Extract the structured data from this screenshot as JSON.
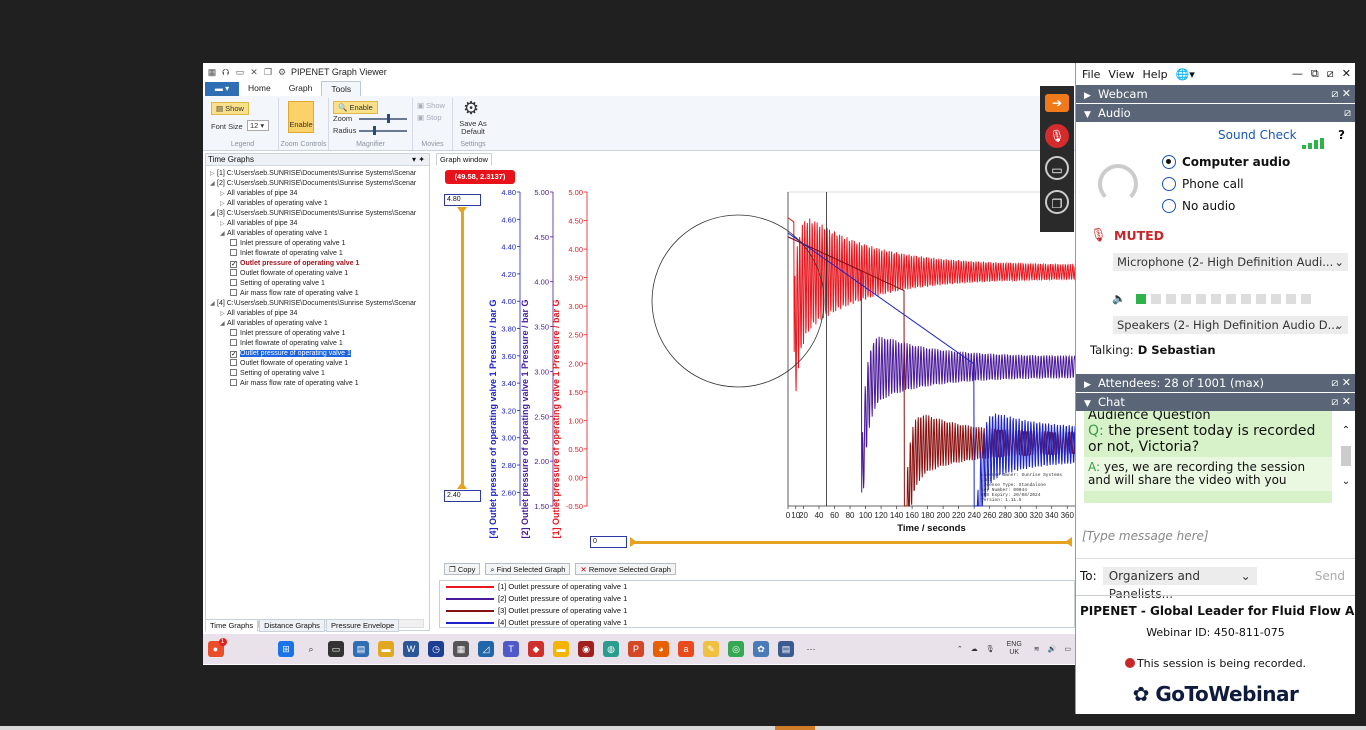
{
  "app": {
    "title": "PIPENET Graph Viewer",
    "tabs": [
      {
        "label": "Home"
      },
      {
        "label": "Graph"
      },
      {
        "label": "Tools"
      }
    ],
    "ribbon": {
      "legend_show": "Show",
      "font_size_label": "Font Size",
      "font_size_value": "12",
      "legend_group": "Legend",
      "zoom_enable": "Enable",
      "zoom_group": "Zoom Controls",
      "mag_enable": "Enable",
      "mag_zoom": "Zoom",
      "mag_radius": "Radius",
      "mag_group": "Magnifier",
      "movie_show": "Show",
      "movie_stop": "Stop",
      "movie_group": "Movies",
      "save_default": "Save As Default",
      "settings_group": "Settings"
    },
    "left_panel": {
      "header": "Time Graphs",
      "tree": [
        {
          "indent": 0,
          "arrow": "▷",
          "cb": false,
          "label": "[1] C:\\Users\\seb.SUNRISE\\Documents\\Sunrise Systems\\Scenar"
        },
        {
          "indent": 0,
          "arrow": "◢",
          "cb": false,
          "label": "[2] C:\\Users\\seb.SUNRISE\\Documents\\Sunrise Systems\\Scenar"
        },
        {
          "indent": 1,
          "arrow": "▷",
          "cb": false,
          "label": "All variables of pipe 34"
        },
        {
          "indent": 1,
          "arrow": "▷",
          "cb": false,
          "label": "All variables of operating valve 1"
        },
        {
          "indent": 0,
          "arrow": "◢",
          "cb": false,
          "label": "[3] C:\\Users\\seb.SUNRISE\\Documents\\Sunrise Systems\\Scenar"
        },
        {
          "indent": 1,
          "arrow": "▷",
          "cb": false,
          "label": "All variables of pipe 34"
        },
        {
          "indent": 1,
          "arrow": "◢",
          "cb": false,
          "label": "All variables of operating valve 1"
        },
        {
          "indent": 2,
          "arrow": "",
          "cb": "off",
          "label": "Inlet pressure of operating valve 1"
        },
        {
          "indent": 2,
          "arrow": "",
          "cb": "off",
          "label": "Inlet flowrate of operating valve 1"
        },
        {
          "indent": 2,
          "arrow": "",
          "cb": "on",
          "style": "red",
          "label": "Outlet pressure of operating valve 1"
        },
        {
          "indent": 2,
          "arrow": "",
          "cb": "off",
          "label": "Outlet flowrate of operating valve 1"
        },
        {
          "indent": 2,
          "arrow": "",
          "cb": "off",
          "label": "Setting of operating valve 1"
        },
        {
          "indent": 2,
          "arrow": "",
          "cb": "off",
          "label": "Air mass flow rate of operating valve 1"
        },
        {
          "indent": 0,
          "arrow": "◢",
          "cb": false,
          "label": "[4] C:\\Users\\seb.SUNRISE\\Documents\\Sunrise Systems\\Scenar"
        },
        {
          "indent": 1,
          "arrow": "▷",
          "cb": false,
          "label": "All variables of pipe 34"
        },
        {
          "indent": 1,
          "arrow": "◢",
          "cb": false,
          "label": "All variables of operating valve 1"
        },
        {
          "indent": 2,
          "arrow": "",
          "cb": "off",
          "label": "Inlet pressure of operating valve 1"
        },
        {
          "indent": 2,
          "arrow": "",
          "cb": "off",
          "label": "Inlet flowrate of operating valve 1"
        },
        {
          "indent": 2,
          "arrow": "",
          "cb": "on",
          "style": "sel",
          "label": "Outlet pressure of operating valve 1"
        },
        {
          "indent": 2,
          "arrow": "",
          "cb": "off",
          "label": "Outlet flowrate of operating valve 1"
        },
        {
          "indent": 2,
          "arrow": "",
          "cb": "off",
          "label": "Setting of operating valve 1"
        },
        {
          "indent": 2,
          "arrow": "",
          "cb": "off",
          "label": "Air mass flow rate of operating valve 1"
        }
      ],
      "bottom_tabs": [
        "Time Graphs",
        "Distance Graphs",
        "Pressure Envelope"
      ]
    },
    "graph": {
      "window_tab": "Graph window",
      "coord_badge": "(49.58, 2.3137)",
      "top_value": "4.80",
      "bottom_value": "2.40",
      "x_start_value": "0",
      "buttons": {
        "copy": "Copy",
        "find": "Find Selected Graph",
        "remove": "Remove Selected Graph"
      },
      "legend": [
        {
          "label": "[1] Outlet pressure of operating valve 1",
          "color": "#e8171f"
        },
        {
          "label": "[2] Outlet pressure of operating valve 1",
          "color": "#4a1a9a"
        },
        {
          "label": "[3] Outlet pressure of operating valve 1",
          "color": "#8a1010"
        },
        {
          "label": "[4] Outlet pressure of operating valve 1",
          "color": "#1a22c8"
        }
      ],
      "license_lines": [
        "License Owner: Sunrise Systems Limi",
        "License Type: Standalone",
        "Key Number: 00044",
        "MUS Expiry: 20/08/2024",
        "Version: 1.11.5"
      ]
    }
  },
  "chart_data": {
    "type": "line",
    "xlabel": "Time / seconds",
    "x_ticks": [
      0,
      10,
      20,
      40,
      60,
      80,
      100,
      120,
      140,
      160,
      180,
      200,
      220,
      240,
      260,
      280,
      300,
      320,
      340,
      360
    ],
    "axes": [
      {
        "label": "[4] Outlet pressure of operating valve 1 Pressure / bar G",
        "color": "#1a22c8",
        "ticks": [
          "4.80",
          "4.60",
          "4.40",
          "4.20",
          "4.00",
          "3.80",
          "3.60",
          "3.40",
          "3.20",
          "3.00",
          "2.80",
          "2.60"
        ],
        "ylim": [
          2.5,
          4.8
        ]
      },
      {
        "label": "[2] Outlet pressure of operating valve 1 Pressure / bar G",
        "color": "#4a1a9a",
        "ticks": [
          "5.00",
          "4.50",
          "4.00",
          "3.50",
          "3.00",
          "2.50",
          "2.00",
          "1.50"
        ],
        "ylim": [
          1.5,
          5.0
        ]
      },
      {
        "label": "[1] Outlet pressure of operating valve 1 Pressure / bar G",
        "color": "#e8171f",
        "ticks": [
          "5.00",
          "4.50",
          "4.00",
          "3.50",
          "3.00",
          "2.50",
          "2.00",
          "1.50",
          "1.00",
          "0.50",
          "0.00",
          "-0.50"
        ],
        "ylim": [
          -0.5,
          5.0
        ]
      }
    ],
    "xlim": [
      0,
      370
    ],
    "cursor_x": 49.58,
    "series": [
      {
        "name": "[1] Outlet pressure of operating valve 1",
        "color": "#e8171f",
        "base": 3.6,
        "amp0": 1.1,
        "dropx": 8,
        "decay": 0.004,
        "period": 3.2,
        "axis": 2
      },
      {
        "name": "[2] Outlet pressure of operating valve 1",
        "color": "#4a1a9a",
        "base": 3.05,
        "amp0": 0.35,
        "dropx": 95,
        "decay": 0.005,
        "period": 3.6,
        "axis": 1
      },
      {
        "name": "[3] Outlet pressure of operating valve 1",
        "color": "#8a1010",
        "base": 2.2,
        "amp0": 0.35,
        "dropx": 150,
        "decay": 0.006,
        "period": 3.4,
        "axis": 1
      },
      {
        "name": "[4] Outlet pressure of operating valve 1",
        "color": "#1a22c8",
        "base": 2.95,
        "amp0": 0.2,
        "dropx": 240,
        "decay": 0.006,
        "period": 3.8,
        "axis": 0
      }
    ]
  },
  "goto": {
    "menu": [
      "File",
      "View",
      "Help"
    ],
    "webcam": "Webcam",
    "audio": "Audio",
    "sound_check": "Sound Check",
    "options": [
      {
        "label": "Computer audio",
        "on": true
      },
      {
        "label": "Phone call",
        "on": false
      },
      {
        "label": "No audio",
        "on": false
      }
    ],
    "muted": "MUTED",
    "microphone": "Microphone (2- High Definition Audi...",
    "speakers": "Speakers (2- High Definition Audio D...",
    "talking_label": "Talking:",
    "talking_name": "D Sebastian",
    "attendees": "Attendees:  28 of 1001 (max)",
    "chat": "Chat",
    "chat_title": "Audience Question",
    "chat_q_prefix": "Q:",
    "chat_q": "the present today is recorded or not, Victoria?",
    "chat_a_prefix": "A:",
    "chat_a": "yes, we are recording the session and will share the video with you",
    "type_placeholder": "[Type message here]",
    "to_label": "To:",
    "to_value": "Organizers and Panelists...",
    "send": "Send",
    "org_name": "PIPENET - Global Leader for Fluid Flow Ana...",
    "webinar_id": "Webinar ID: 450-811-075",
    "recording": "This session is being recorded.",
    "brand": "GoToWebinar"
  },
  "taskbar": {
    "lang": "ENG",
    "region": "UK",
    "badge": "1"
  }
}
